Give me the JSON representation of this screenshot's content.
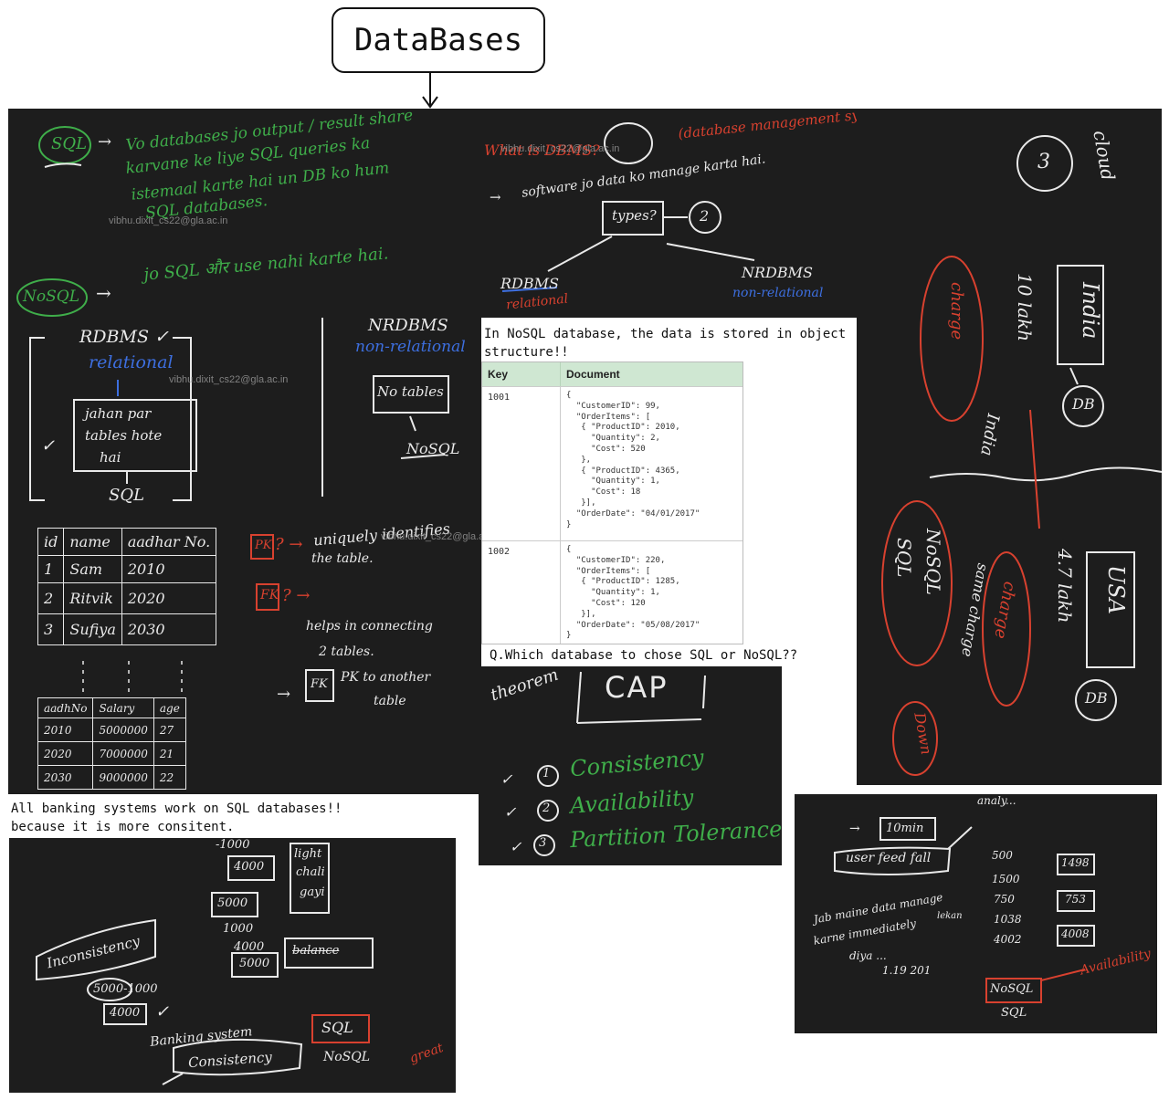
{
  "title": "DataBases",
  "panel_sql_nosql": {
    "sql_label": "SQL",
    "sql_line1": "Vo databases jo output / result share",
    "sql_line2": "karvane ke liye SQL queries ka",
    "sql_line3": "istemaal karte hai un DB ko hum",
    "sql_line4": "SQL databases.",
    "nosql_label": "NoSQL",
    "nosql_line": "jo SQL और use nahi karte hai."
  },
  "panel_dbms": {
    "question": "What is DBMS?",
    "expansion": "(database management system)",
    "software_line": "software jo data ko manage karta hai.",
    "types_label": "types?",
    "types_count": "2",
    "rdbms": "RDBMS",
    "rdbms_sub": "relational",
    "nrdbms": "NRDBMS",
    "nrdbms_sub": "non-relational"
  },
  "panel_cloud": {
    "cloud": "cloud",
    "cloud_num": "3",
    "india": "India",
    "india2": "India",
    "lakh_left": "10 lakh",
    "charge": "charge",
    "db1": "DB",
    "usa": "USA",
    "lakh_right": "4.7 lakh",
    "charge2": "charge",
    "same_charge": "same charge",
    "nosql": "NoSQL",
    "sql": "SQL",
    "down": "Down",
    "db2": "DB"
  },
  "panel_rdbms": {
    "rdbms": "RDBMS ✓",
    "relational": "relational",
    "jahan_line1": "jahan par",
    "jahan_line2": "tables hote",
    "jahan_line3": "hai",
    "sql": "SQL",
    "nrdbms": "NRDBMS",
    "non_relational": "non-relational",
    "no_tables": "No tables",
    "nosql": "NoSQL"
  },
  "nosql_note": "In NoSQL database, the data is stored in object structure!!",
  "doc_table": {
    "col_key": "Key",
    "col_document": "Document",
    "rows": [
      {
        "key": "1001",
        "doc": "{\n  \"CustomerID\": 99,\n  \"OrderItems\": [\n   { \"ProductID\": 2010,\n     \"Quantity\": 2,\n     \"Cost\": 520\n   },\n   { \"ProductID\": 4365,\n     \"Quantity\": 1,\n     \"Cost\": 18\n   }],\n  \"OrderDate\": \"04/01/2017\"\n}"
      },
      {
        "key": "1002",
        "doc": "{\n  \"CustomerID\": 220,\n  \"OrderItems\": [\n   { \"ProductID\": 1285,\n     \"Quantity\": 1,\n     \"Cost\": 120\n   }],\n  \"OrderDate\": \"05/08/2017\"\n}"
      }
    ]
  },
  "question_note": "Q.Which database to chose SQL or NoSQL??",
  "panel_keys": {
    "green_headers": [
      "id",
      "name",
      "aadhar No."
    ],
    "green_rows": [
      [
        "1",
        "Sam",
        "2010"
      ],
      [
        "2",
        "Ritvik",
        "2020"
      ],
      [
        "3",
        "Sufiya",
        "2030"
      ]
    ],
    "blue_headers": [
      "aadhNo",
      "Salary",
      "age"
    ],
    "blue_rows": [
      [
        "2010",
        "5000000",
        "27"
      ],
      [
        "2020",
        "7000000",
        "21"
      ],
      [
        "2030",
        "9000000",
        "22"
      ]
    ],
    "pk": "PK",
    "pk_desc1": "uniquely identifies",
    "pk_desc2": "the table.",
    "fk": "FK",
    "fk_desc1": "helps in connecting",
    "fk_desc2": "2 tables.",
    "fk_box": "FK",
    "fk_desc3": "PK to another",
    "fk_desc4": "table"
  },
  "panel_cap": {
    "theorem": "theorem",
    "cap": "CAP",
    "items": [
      "Consistency",
      "Availability",
      "Partition Tolerance"
    ],
    "nums": [
      "1",
      "2",
      "3"
    ]
  },
  "banking_note1": "All banking systems work on SQL databases!!",
  "banking_note2": "because it is more consitent.",
  "panel_banking": {
    "v1000": "-1000",
    "v4000": "4000",
    "light": "light",
    "chali": "chali",
    "gayi": "gayi",
    "v5000": "5000",
    "v1000b": "1000",
    "v4000b": "4000",
    "v5000b": "5000",
    "balance": "balance",
    "inconsistency": "Inconsistency",
    "calc": "5000-1000",
    "v4000c": "4000",
    "banking_system": "Banking system",
    "consistency": "Consistency",
    "sql": "SQL",
    "nosql": "NoSQL",
    "great": "great"
  },
  "panel_avail": {
    "ten_min": "10min",
    "user_feed_fall": "user feed fall",
    "analytics": "analy...",
    "line1": "Jab maine data manage",
    "line2": "karne immediately",
    "line3": "lekan",
    "line4": "diya ...",
    "line5": "1.19 201",
    "pairs": [
      [
        "500",
        "1498"
      ],
      [
        "1500",
        "753"
      ],
      [
        "750",
        ""
      ],
      [
        "1038",
        "4008"
      ],
      [
        "4002",
        ""
      ]
    ],
    "nosql": "NoSQL",
    "sql": "SQL",
    "availability": "Availability"
  },
  "watermark": "vibhu.dixit_cs22@gla.ac.in"
}
